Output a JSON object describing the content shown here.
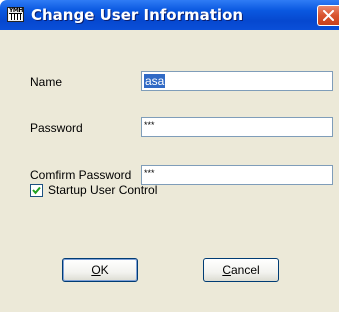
{
  "window": {
    "title": "Change User Information",
    "app_icon": "yamaha-keyboard-icon",
    "close_icon": "close-icon"
  },
  "form": {
    "name_label": "Name",
    "name_value": "asa",
    "password_label": "Password",
    "password_value": "***",
    "confirm_label": "Comfirm Password",
    "confirm_value": "***",
    "startup_label": "Startup User Control",
    "startup_checked": true
  },
  "buttons": {
    "ok_mnemonic": "O",
    "ok_rest": "K",
    "cancel_mnemonic": "C",
    "cancel_rest": "ancel"
  },
  "colors": {
    "titlebar": "#0a58e0",
    "dialog_bg": "#ece9d8",
    "close_button": "#d9542e",
    "selection": "#316ac5"
  }
}
